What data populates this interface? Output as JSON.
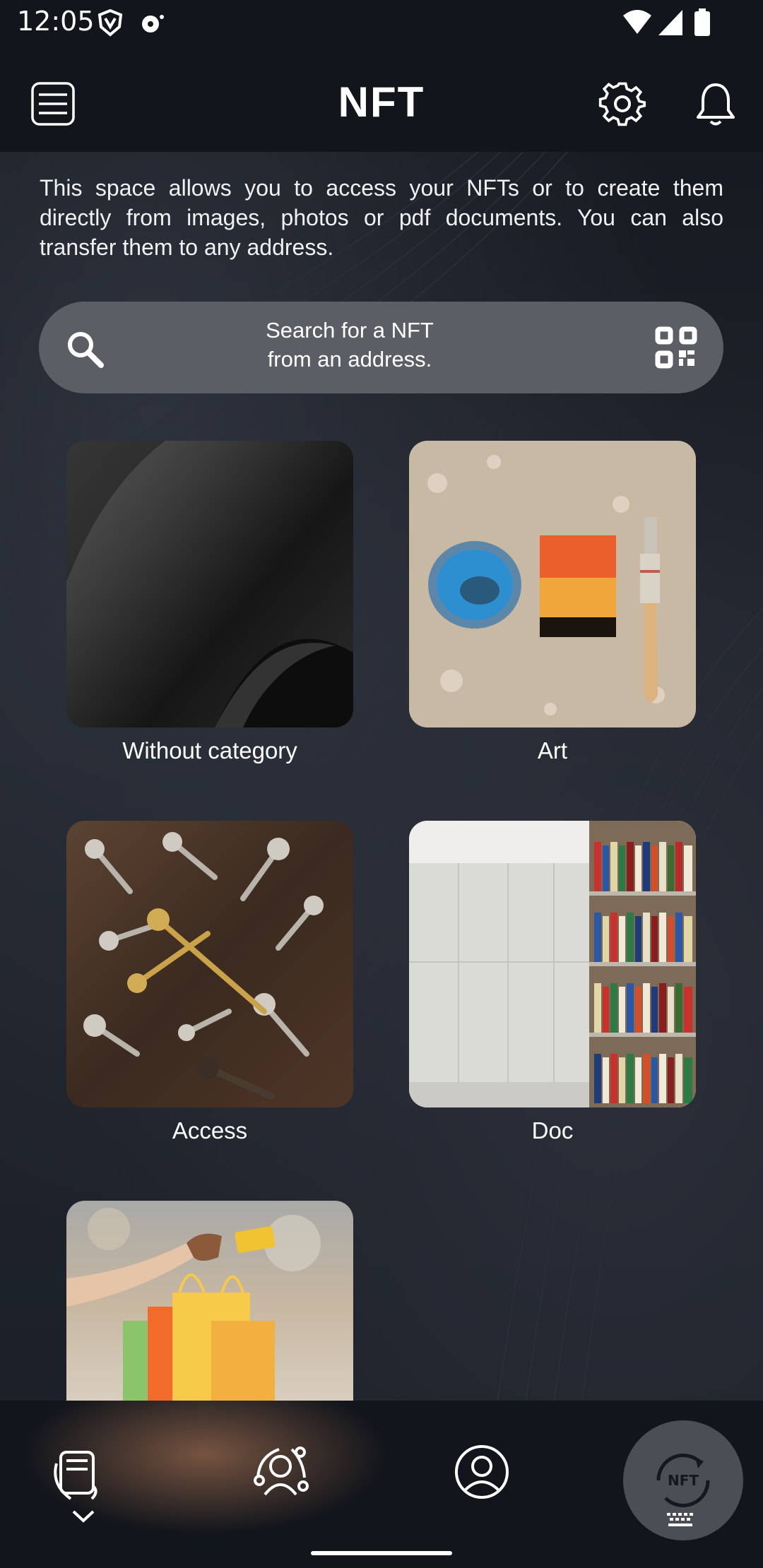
{
  "status_bar": {
    "time": "12:05",
    "icons": [
      "vpn-shield-icon",
      "sync-icon",
      "wifi-icon",
      "signal-icon",
      "battery-icon"
    ]
  },
  "header": {
    "title": "NFT",
    "icons": [
      "menu-icon",
      "gear-icon",
      "bell-icon"
    ]
  },
  "intro": {
    "text": "This space allows you to access your NFTs or to create them directly from images, photos or pdf documents. You can also transfer them to any address."
  },
  "search": {
    "placeholder": "Search for a NFT\nfrom an address.",
    "icons": [
      "search-icon",
      "qr-code-icon"
    ]
  },
  "categories": [
    {
      "label": "Without category"
    },
    {
      "label": "Art"
    },
    {
      "label": "Access"
    },
    {
      "label": "Doc"
    },
    {
      "label": ""
    }
  ],
  "bottom_nav": {
    "items": [
      "wallet-icon",
      "network-user-icon",
      "profile-icon",
      "nft-icon"
    ],
    "extra_icons": [
      "chevron-down-icon",
      "keyboard-icon"
    ]
  },
  "colors": {
    "background": "#12151b",
    "search_bg": "#5b5e64",
    "fab_bg": "#4b4e54"
  }
}
